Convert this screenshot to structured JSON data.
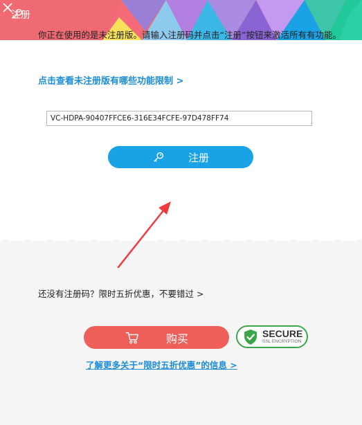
{
  "window": {
    "title": "注册"
  },
  "colors": {
    "accent_blue": "#1aa2e6",
    "buy_red": "#ef5f5a",
    "link_blue": "#1a8cd8",
    "secure_green": "#3aa64a"
  },
  "body": {
    "notice": "你正在使用的是未注册版。请输入注册码并点击“注册”按钮来激活所有有功能。",
    "limit_link": "点击查看未注册版有哪些功能限制 >",
    "code_value": "VC-HDPA-90407FFCE6-316E34FCFE-97D478FF74",
    "register_label": "注册"
  },
  "purchase": {
    "promo_text": "还没有注册码？限时五折优惠，不要错过 >",
    "buy_label": "购买",
    "secure_title": "SECURE",
    "secure_sub": "SSL ENCRYPTION",
    "info_link": "了解更多关于“限时五折优惠”的信息 >"
  },
  "icons": [
    "key-icon",
    "close-icon",
    "cart-icon",
    "shield-check-icon"
  ]
}
